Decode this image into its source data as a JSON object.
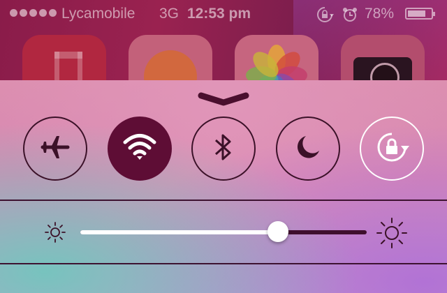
{
  "status_bar": {
    "signal_dots": 5,
    "carrier": "Lycamobile",
    "network": "3G",
    "time": "12:53 pm",
    "icons": [
      "rotation-lock-icon",
      "alarm-icon"
    ],
    "battery_percent": "78%",
    "battery_level": 0.78
  },
  "home_screen": {
    "apps": [
      {
        "icon": "music-app-icon"
      },
      {
        "icon": "game-center-app-icon"
      },
      {
        "icon": "photos-app-icon"
      },
      {
        "icon": "camera-app-icon"
      }
    ]
  },
  "control_center": {
    "grabber_icon": "chevron-down-icon",
    "toggles": [
      {
        "icon": "airplane-icon",
        "state": "off"
      },
      {
        "icon": "wifi-icon",
        "state": "on"
      },
      {
        "icon": "bluetooth-icon",
        "state": "off"
      },
      {
        "icon": "moon-icon",
        "state": "off"
      },
      {
        "icon": "rotation-lock-icon",
        "state": "on"
      }
    ],
    "brightness": {
      "value": 0.69,
      "low_icon": "sun-small-icon",
      "high_icon": "sun-large-icon"
    },
    "colors": {
      "toggle_on": "#5e0d35",
      "toggle_outline": "#3b1128",
      "rotation_lock_active": "#ffffff"
    }
  }
}
